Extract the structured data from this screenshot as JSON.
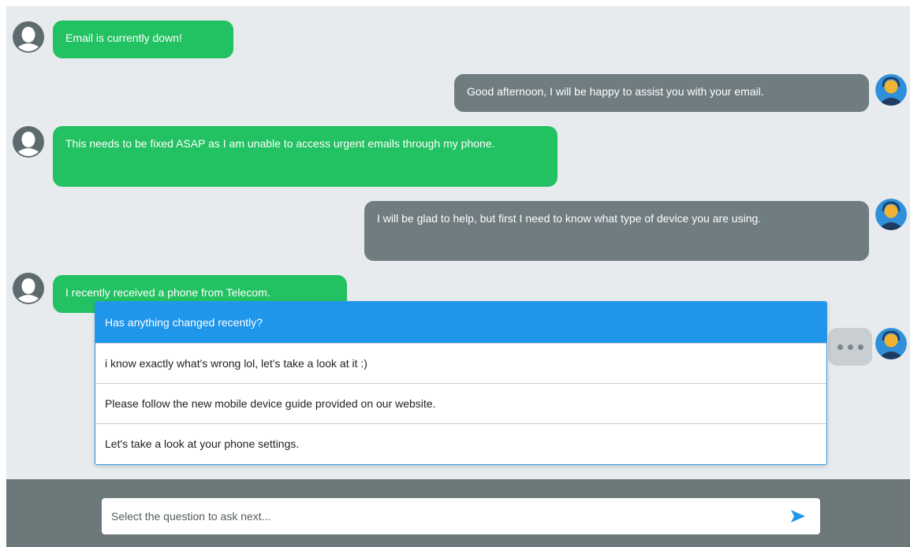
{
  "conversation": {
    "messages": [
      {
        "sender": "customer",
        "text": "Email is currently down!"
      },
      {
        "sender": "agent",
        "text": "Good afternoon, I will be happy to assist you with your email."
      },
      {
        "sender": "customer",
        "text": "This needs to be fixed ASAP as I am unable to access urgent emails through my phone."
      },
      {
        "sender": "agent",
        "text": "I will be glad to help, but first I need to know what type of device you are using."
      },
      {
        "sender": "customer",
        "text": "I recently received a phone from Telecom."
      }
    ],
    "agent_typing": true
  },
  "question_menu": {
    "header": "Has anything changed recently?",
    "options": [
      "i know exactly what's wrong lol, let's take a look at it :)",
      "Please follow the new mobile device guide provided on our website.",
      "Let's take a look at your phone settings."
    ]
  },
  "composer": {
    "placeholder": "Select the question to ask next..."
  },
  "colors": {
    "customer_bubble": "#22c161",
    "agent_bubble": "#6f7c80",
    "menu_accent": "#1f96e9",
    "send_icon": "#1f96e9"
  },
  "icons": {
    "customer_avatar": "user-silhouette-icon",
    "agent_avatar": "agent-headset-icon",
    "send": "send-arrow-icon"
  }
}
